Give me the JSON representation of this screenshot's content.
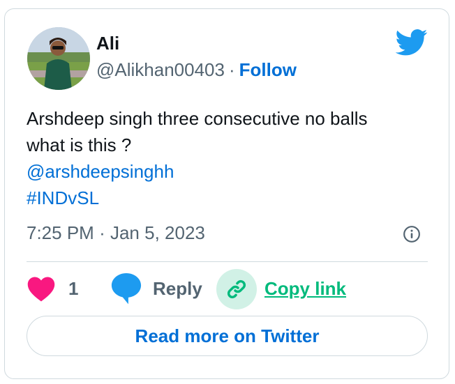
{
  "author": {
    "name": "Ali",
    "handle": "@Alikhan00403",
    "separator": "·",
    "follow_label": "Follow"
  },
  "tweet": {
    "text_line1": "Arshdeep singh three consecutive no balls",
    "text_line2": "what is this ?",
    "mention": "@arshdeepsinghh",
    "hashtag": "#INDvSL",
    "time": "7:25 PM",
    "date": "Jan 5, 2023",
    "meta_separator": "·"
  },
  "actions": {
    "like_count": "1",
    "reply_label": "Reply",
    "copy_link_label": "Copy link"
  },
  "footer": {
    "read_more_label": "Read more on Twitter"
  },
  "icons": {
    "bird": "twitter-bird-icon",
    "info": "info-icon",
    "heart": "heart-icon",
    "reply": "speech-bubble-icon",
    "link": "chain-link-icon"
  },
  "colors": {
    "link_blue": "#006fd6",
    "twitter_blue": "#1d9bf0",
    "heart_pink": "#f91880",
    "copy_green": "#00ba7c",
    "copy_green_bg": "#d1f1e6",
    "muted_text": "#536471",
    "border": "#cfd9de"
  }
}
